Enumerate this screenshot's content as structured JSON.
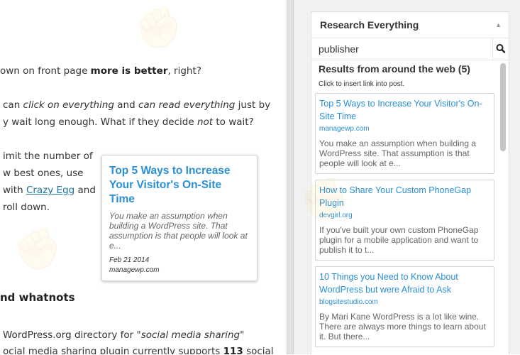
{
  "editor": {
    "lines": [
      {
        "parts": [
          {
            "t": "own on front page ",
            "s": "n"
          },
          {
            "t": "more is better",
            "s": "b"
          },
          {
            "t": ", right?",
            "s": "n"
          }
        ]
      },
      {
        "parts": [
          {
            "t": "can ",
            "s": "n"
          },
          {
            "t": "click on everything",
            "s": "i"
          },
          {
            "t": " and ",
            "s": "n"
          },
          {
            "t": "can read everything",
            "s": "i"
          },
          {
            "t": " just by",
            "s": "n"
          }
        ]
      },
      {
        "parts": [
          {
            "t": "y wait long enough. What if they decide ",
            "s": "n"
          },
          {
            "t": "not",
            "s": "i"
          },
          {
            "t": " to wait?",
            "s": "n"
          }
        ]
      },
      {
        "parts": [
          {
            "t": "imit the number of",
            "s": "n"
          }
        ]
      },
      {
        "parts": [
          {
            "t": "w best ones, use",
            "s": "n"
          }
        ]
      },
      {
        "parts": [
          {
            "t": "with ",
            "s": "n"
          },
          {
            "t": "Crazy Egg",
            "s": "a"
          },
          {
            "t": " and",
            "s": "n"
          }
        ]
      },
      {
        "parts": [
          {
            "t": "roll down.",
            "s": "n"
          }
        ]
      },
      {
        "parts": [
          {
            "t": "WordPress.org directory for \"",
            "s": "n"
          },
          {
            "t": "social media sharing",
            "s": "i"
          },
          {
            "t": "\"",
            "s": "n"
          }
        ]
      },
      {
        "parts": [
          {
            "t": "ocial media sharing plugin currently supports ",
            "s": "n"
          },
          {
            "t": "113",
            "s": "b"
          },
          {
            "t": " social",
            "s": "n"
          }
        ]
      }
    ],
    "heading": "nd whatnots",
    "card": {
      "title": "Top 5 Ways to Increase Your Visitor's On-Site Time",
      "excerpt": "You make an assumption when building a WordPress site. That assumption is that people will look at e...",
      "date": "Feb 21 2014",
      "domain": "managewp.com"
    }
  },
  "sidebar": {
    "title": "Research Everything",
    "search_value": "publisher",
    "results_heading": "Results from around the web (5)",
    "results_hint": "Click to insert link into post.",
    "results": [
      {
        "title": "Top 5 Ways to Increase Your Visitor's On-Site Time",
        "domain": "managewp.com",
        "excerpt": "You make an assumption when building a WordPress site. That assumption is that people will look at e..."
      },
      {
        "title": "How to Share Your Custom PhoneGap Plugin",
        "domain": "devgirl.org",
        "excerpt": "If you've built your own custom PhoneGap plugin for a mobile application and want to publish it to t..."
      },
      {
        "title": "10 Things you Need to Know About WordPress but were Afraid to Ask",
        "domain": "blogsitestudio.com",
        "excerpt": "By Mari Kane WordPress is a lot like wine. There are always more things to learn about it. But there..."
      }
    ]
  },
  "colors": {
    "link": "#2a8fd6",
    "editor_link": "#21759b",
    "sidebar_bg": "#f1f1f1"
  }
}
